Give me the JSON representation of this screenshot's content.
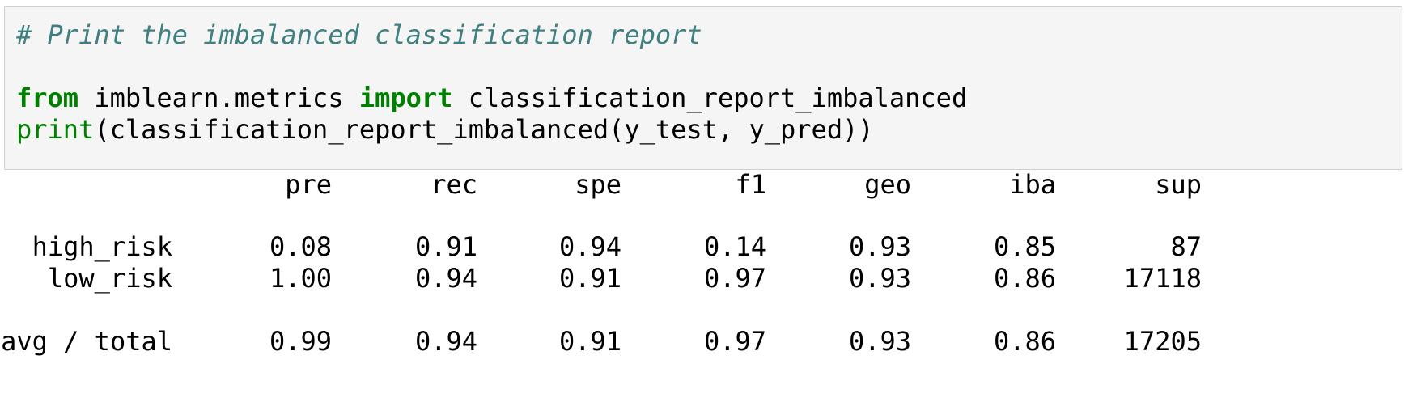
{
  "code": {
    "comment": "# Print the imbalanced classification report",
    "line2": {
      "kw_from": "from",
      "module": " imblearn.metrics ",
      "kw_import": "import",
      "name": " classification_report_imbalanced"
    },
    "line3": {
      "builtin": "print",
      "rest": "(classification_report_imbalanced(y_test, y_pred))"
    }
  },
  "report": {
    "headers": [
      "pre",
      "rec",
      "spe",
      "f1",
      "geo",
      "iba",
      "sup"
    ],
    "rows": [
      {
        "label": "high_risk",
        "values": [
          "0.08",
          "0.91",
          "0.94",
          "0.14",
          "0.93",
          "0.85",
          "87"
        ]
      },
      {
        "label": "low_risk",
        "values": [
          "1.00",
          "0.94",
          "0.91",
          "0.97",
          "0.93",
          "0.86",
          "17118"
        ]
      }
    ],
    "total": {
      "label": "avg / total",
      "values": [
        "0.99",
        "0.94",
        "0.91",
        "0.97",
        "0.93",
        "0.86",
        "17205"
      ]
    }
  }
}
